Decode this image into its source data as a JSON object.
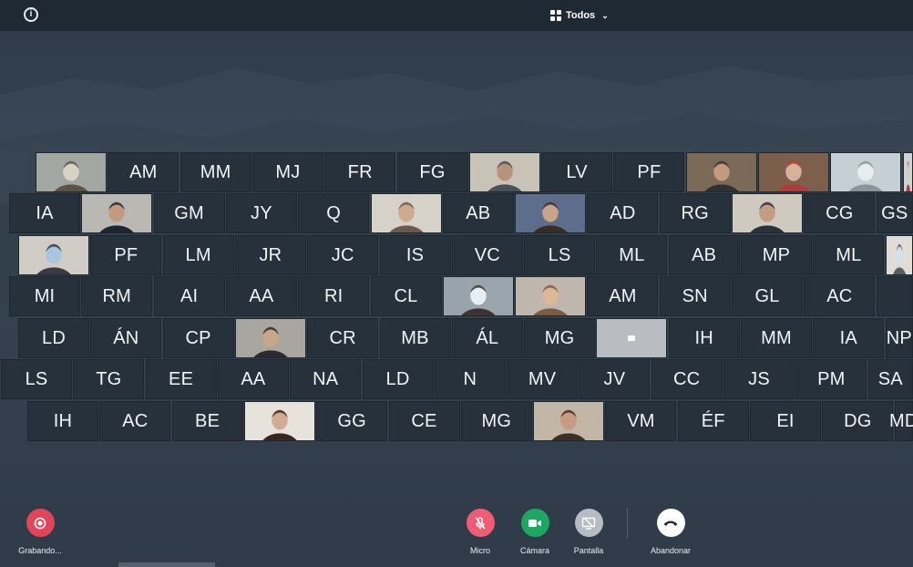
{
  "topbar": {
    "layout_label": "Todos",
    "info_icon": "info-icon",
    "layout_icon": "grid-icon"
  },
  "grid": {
    "rows": [
      [
        "v:woman-headset",
        "AM",
        "MM",
        "MJ",
        "FR",
        "FG",
        "v:man-sitting",
        "LV",
        "PF",
        "v:man-glasses",
        "v:woman-office",
        "v:window-room",
        "v:woman-red"
      ],
      [
        "IA",
        "v:man-suit",
        "GM",
        "JY",
        "Q",
        "v:woman-blonde",
        "AB",
        "v:woman-hair",
        "AD",
        "RG",
        "v:man-desk",
        "CG",
        "GS"
      ],
      [
        "v:woman-mask",
        "PF",
        "LM",
        "JR",
        "JC",
        "IS",
        "VC",
        "LS",
        "ML",
        "AB",
        "MP",
        "ML",
        "v:man-mask"
      ],
      [
        "MI",
        "RM",
        "AI",
        "AA",
        "RI",
        "CL",
        "v:man-mask2",
        "v:woman-blonde2",
        "AM",
        "SN",
        "GL",
        "AC",
        ""
      ],
      [
        "LD",
        "ÁN",
        "CP",
        "v:woman-hands",
        "CR",
        "MB",
        "ÁL",
        "MG",
        "nocam",
        "IH",
        "MM",
        "IA",
        "NP"
      ],
      [
        "LS",
        "TG",
        "EE",
        "AA",
        "NA",
        "LD",
        "N",
        "MV",
        "JV",
        "CC",
        "JS",
        "PM",
        "SA"
      ],
      [
        "IH",
        "AC",
        "BE",
        "v:woman-dark",
        "GG",
        "CE",
        "MG",
        "v:man-tie",
        "VM",
        "ÉF",
        "EI",
        "DG",
        "MD"
      ]
    ]
  },
  "controls": {
    "record_label": "Grabando...",
    "mic_label": "Micro",
    "camera_label": "Cámara",
    "screen_label": "Pantalla",
    "leave_label": "Abandonar"
  },
  "colors": {
    "record": "#e0455a",
    "mic": "#ef5c73",
    "camera": "#1ea760",
    "screen": "#b7bcc2",
    "leave": "#ffffff",
    "tile": "#27313c",
    "topbar": "#1f2933"
  }
}
